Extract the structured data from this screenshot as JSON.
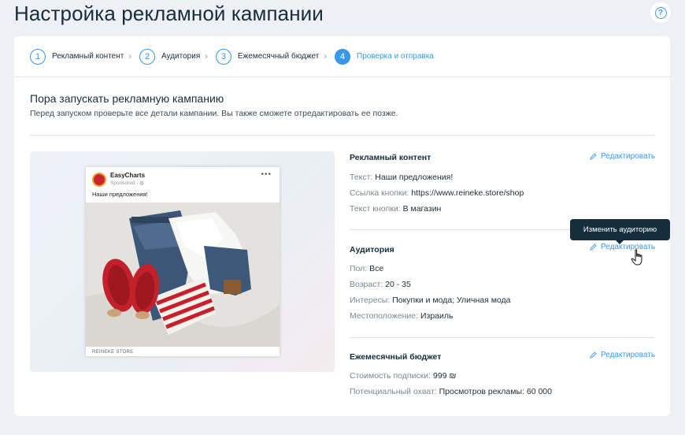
{
  "header": {
    "title": "Настройка рекламной кампании",
    "help_icon": "help-icon"
  },
  "stepper": {
    "steps": [
      {
        "num": "1",
        "label": "Рекламный контент"
      },
      {
        "num": "2",
        "label": "Аудитория"
      },
      {
        "num": "3",
        "label": "Ежемесячный бюджет"
      },
      {
        "num": "4",
        "label": "Проверка и отправка"
      }
    ],
    "active_step": 4
  },
  "main": {
    "title": "Пора запускать рекламную кампанию",
    "subtitle": "Перед запуском проверьте все детали кампании. Вы также сможете отредактировать ее позже."
  },
  "ad_preview": {
    "page_name": "EasyCharts",
    "sponsored": "Sponsored",
    "text": "Наши предложения!",
    "footer": "REINEKE STORE"
  },
  "sections": {
    "content": {
      "title": "Рекламный контент",
      "edit_label": "Редактировать",
      "rows": [
        {
          "key": "Текст:",
          "value": "Наши предложения!"
        },
        {
          "key": "Ссылка кнопки:",
          "value": "https://www.reineke.store/shop"
        },
        {
          "key": "Текст кнопки:",
          "value": "В магазин"
        }
      ]
    },
    "audience": {
      "title": "Аудитория",
      "edit_label": "Редактировать",
      "rows": [
        {
          "key": "Пол:",
          "value": "Все"
        },
        {
          "key": "Возраст:",
          "value": "20 - 35"
        },
        {
          "key": "Интересы:",
          "value": "Покупки и мода; Уличная мода"
        },
        {
          "key": "Местоположение:",
          "value": "Израиль"
        }
      ]
    },
    "budget": {
      "title": "Ежемесячный бюджет",
      "edit_label": "Редактировать",
      "rows": [
        {
          "key": "Стоимость подписки:",
          "value": "999 ₪"
        },
        {
          "key": "Потенциальный охват:",
          "value": "Просмотров рекламы: 60 000"
        }
      ]
    }
  },
  "tooltip": {
    "text": "Изменить аудиторию"
  },
  "colors": {
    "accent": "#3899ec",
    "dark": "#162d3d",
    "background": "#eef0f5"
  }
}
